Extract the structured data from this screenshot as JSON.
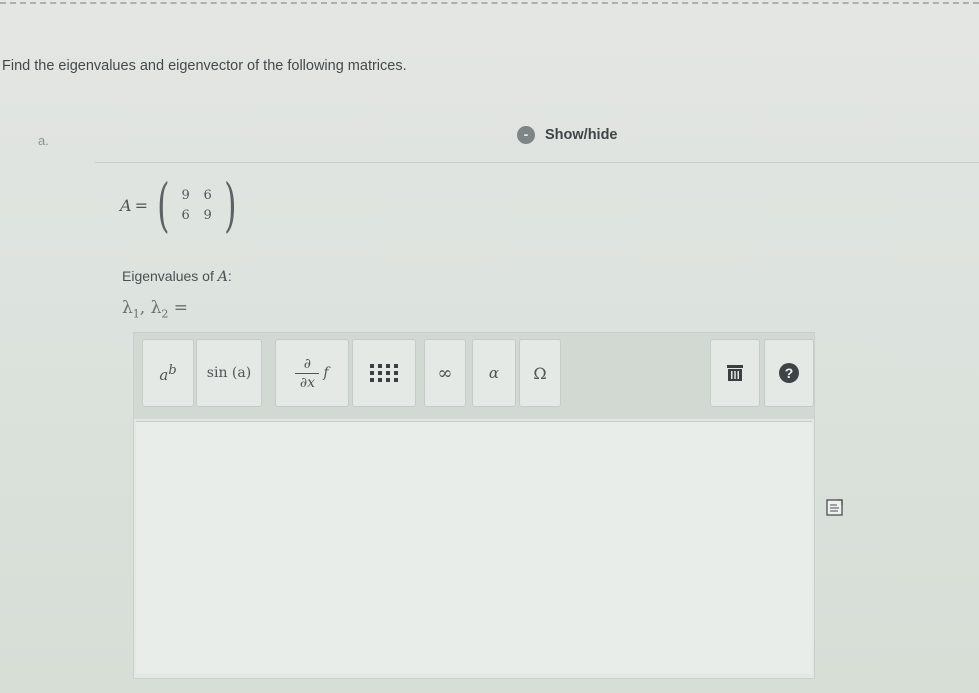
{
  "question": {
    "text": "Find the eigenvalues and eigenvector of the following matrices."
  },
  "part": {
    "label": "a.",
    "toggle_label": "Show/hide",
    "toggle_icon": "minus-circle-icon"
  },
  "matrix": {
    "name": "A",
    "equals": "=",
    "rows": [
      [
        "9",
        "6"
      ],
      [
        "6",
        "9"
      ]
    ]
  },
  "eigen": {
    "label_prefix": "Eigenvalues of ",
    "label_var": "A",
    "label_suffix": ":",
    "lambda1": "λ",
    "sub1": "1",
    "comma": ", ",
    "lambda2": "λ",
    "sub2": "2",
    "equals": " ="
  },
  "toolbar": {
    "power_base": "a",
    "power_exp": "b",
    "sin_label": "sin (a)",
    "deriv_num": "∂",
    "deriv_den": "∂x",
    "deriv_f": "f",
    "infinity": "∞",
    "alpha": "α",
    "omega": "Ω",
    "help": "?"
  },
  "icons": {
    "matrix": "matrix-icon",
    "trash": "trash-icon",
    "help": "help-icon",
    "document": "document-icon"
  }
}
